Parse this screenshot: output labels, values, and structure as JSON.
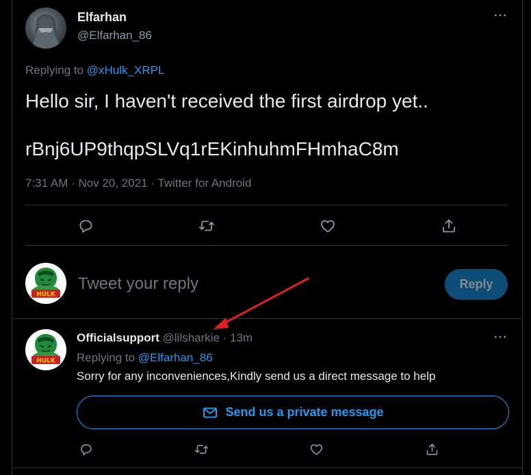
{
  "tweet": {
    "author_name": "Elfarhan",
    "author_handle": "@Elfarhan_86",
    "more": "···",
    "replying_prefix": "Replying to",
    "replying_to": "@xHulk_XRPL",
    "text_line1": "Hello sir, I haven't received the first airdrop yet..",
    "text_line2": "rBnj6UP9thqpSLVq1rEKinhuhmFHmhaC8m",
    "meta": "7:31 AM · Nov 20, 2021 · Twitter for Android"
  },
  "composer": {
    "placeholder": "Tweet your reply",
    "reply_label": "Reply"
  },
  "reply": {
    "author_name": "Officialsupport",
    "author_handle": "@lilsharkie",
    "separator": " · ",
    "time": "13m",
    "more": "···",
    "replying_prefix": "Replying to",
    "replying_to": "@Elfarhan_86",
    "text": "Sorry for any inconveniences,Kindly send us a direct message to help",
    "dm_button_label": "Send us a private message"
  },
  "icons": {
    "reply": "comment-icon",
    "retweet": "retweet-icon",
    "like": "heart-icon",
    "share": "share-icon",
    "envelope": "envelope-icon"
  },
  "colors": {
    "accent": "#1d9bf0",
    "annotation_arrow": "#e02020"
  }
}
